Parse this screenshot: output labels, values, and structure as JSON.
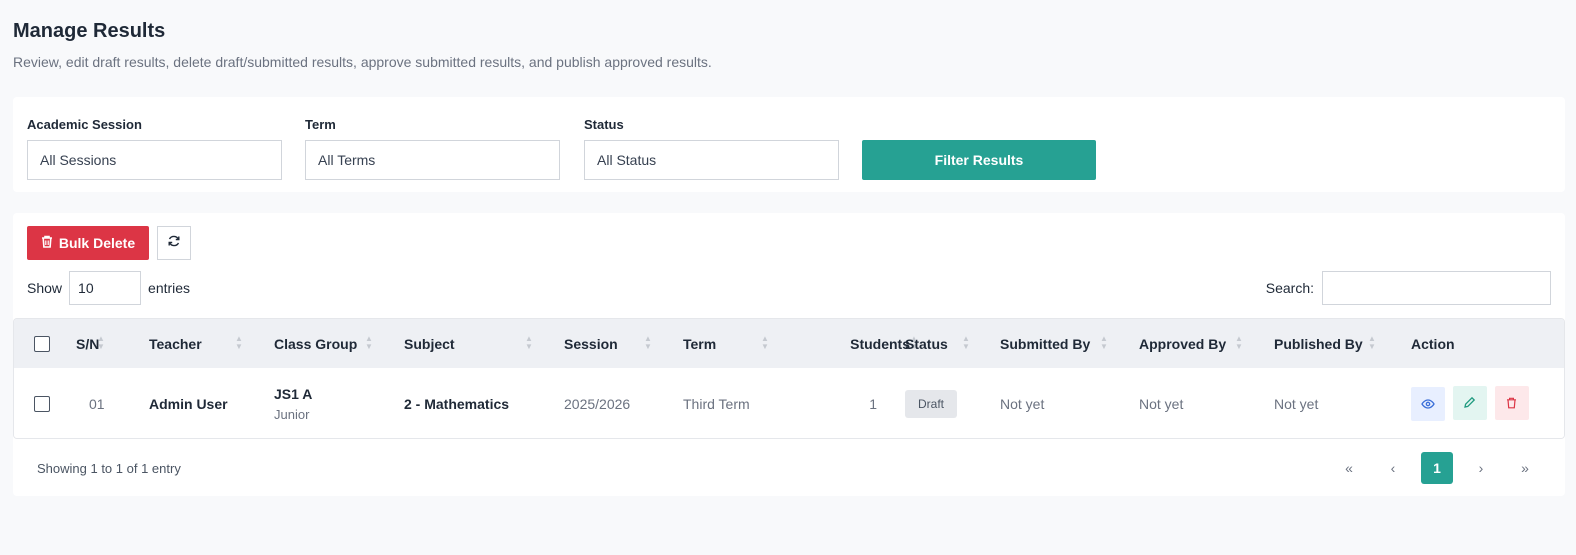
{
  "page": {
    "title": "Manage Results",
    "subtitle": "Review, edit draft results, delete draft/submitted results, approve submitted results, and publish approved results."
  },
  "filters": {
    "session": {
      "label": "Academic Session",
      "value": "All Sessions"
    },
    "term": {
      "label": "Term",
      "value": "All Terms"
    },
    "status": {
      "label": "Status",
      "value": "All Status"
    },
    "submit_label": "Filter Results"
  },
  "toolbar": {
    "bulk_delete_label": "Bulk Delete",
    "refresh_icon": "refresh-icon"
  },
  "length": {
    "show_label": "Show",
    "value": "10",
    "entries_label": "entries"
  },
  "search": {
    "label": "Search:",
    "value": ""
  },
  "table": {
    "headers": {
      "sn": "S/N",
      "teacher": "Teacher",
      "class_group": "Class Group",
      "subject": "Subject",
      "session": "Session",
      "term": "Term",
      "students": "Students",
      "status": "Status",
      "submitted_by": "Submitted By",
      "approved_by": "Approved By",
      "published_by": "Published By",
      "action": "Action"
    },
    "rows": [
      {
        "sn": "01",
        "teacher": "Admin User",
        "class_name": "JS1 A",
        "class_group": "Junior",
        "subject": "2 - Mathematics",
        "session": "2025/2026",
        "term": "Third Term",
        "students": "1",
        "status": "Draft",
        "submitted_by": "Not yet",
        "approved_by": "Not yet",
        "published_by": "Not yet"
      }
    ]
  },
  "footer": {
    "info": "Showing 1 to 1 of 1 entry",
    "pager": {
      "first": "«",
      "prev": "‹",
      "current": "1",
      "next": "›",
      "last": "»"
    }
  },
  "colors": {
    "accent": "#26a193",
    "danger": "#dc3545",
    "view": "#3b6fd8",
    "edit": "#1f9a7f"
  }
}
